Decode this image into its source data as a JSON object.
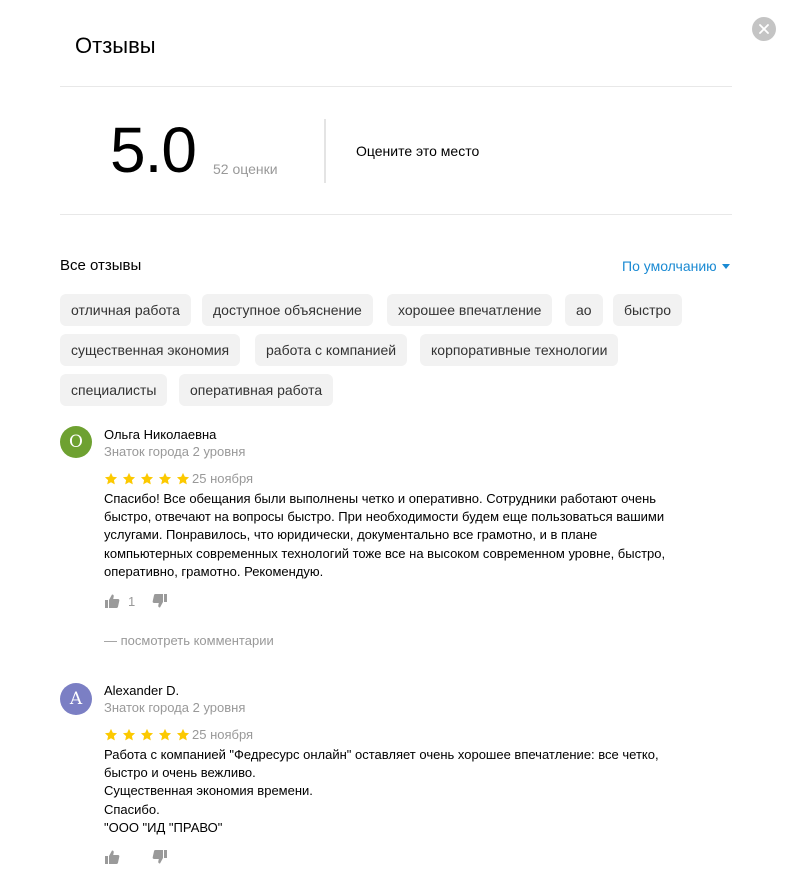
{
  "header": {
    "title": "Отзывы",
    "close_icon": "close-icon"
  },
  "summary": {
    "rating": "5.0",
    "votes": "52 оценки",
    "rate_label": "Оцените это место",
    "star_color": "#fcc900",
    "empty_star_color": "#e6e6e6",
    "filled_stars": 5
  },
  "list": {
    "title": "Все отзывы",
    "sort_label": "По умолчанию",
    "tags": [
      "отличная работа",
      "доступное объяснение",
      "хорошее впечатление",
      "ао",
      "быстро",
      "существенная экономия",
      "работа с компанией",
      "корпоративные технологии",
      "специалисты",
      "оперативная работа"
    ]
  },
  "reviews": [
    {
      "avatar_letter": "О",
      "avatar_color": "#6ea131",
      "author": "Ольга Николаевна",
      "level": "Знаток города 2 уровня",
      "stars": 5,
      "date": "25 ноября",
      "lines": [
        "Спасибо! Все обещания были выполнены четко и оперативно. Сотрудники работают очень",
        "быстро, отвечают на вопросы быстро. При необходимости будем еще пользоваться вашими",
        "услугами. Понравилось, что юридически, документально все грамотно, и в плане",
        "компьютерных современных технологий тоже все на высоком современном уровне, быстро,",
        "оперативно, грамотно. Рекомендую."
      ],
      "likes": "1",
      "comments": "— посмотреть комментарии"
    },
    {
      "avatar_letter": "A",
      "avatar_color": "#7b7fc4",
      "author": "Alexander D.",
      "level": "Знаток города 2 уровня",
      "stars": 5,
      "date": "25 ноября",
      "lines": [
        "Работа с компанией \"Федресурс онлайн\" оставляет очень хорошее впечатление: все четко,",
        "быстро и очень вежливо.",
        "Существенная экономия времени.",
        "Спасибо.",
        "\"ООО \"ИД \"ПРАВО\""
      ],
      "likes": "",
      "comments": ""
    }
  ]
}
